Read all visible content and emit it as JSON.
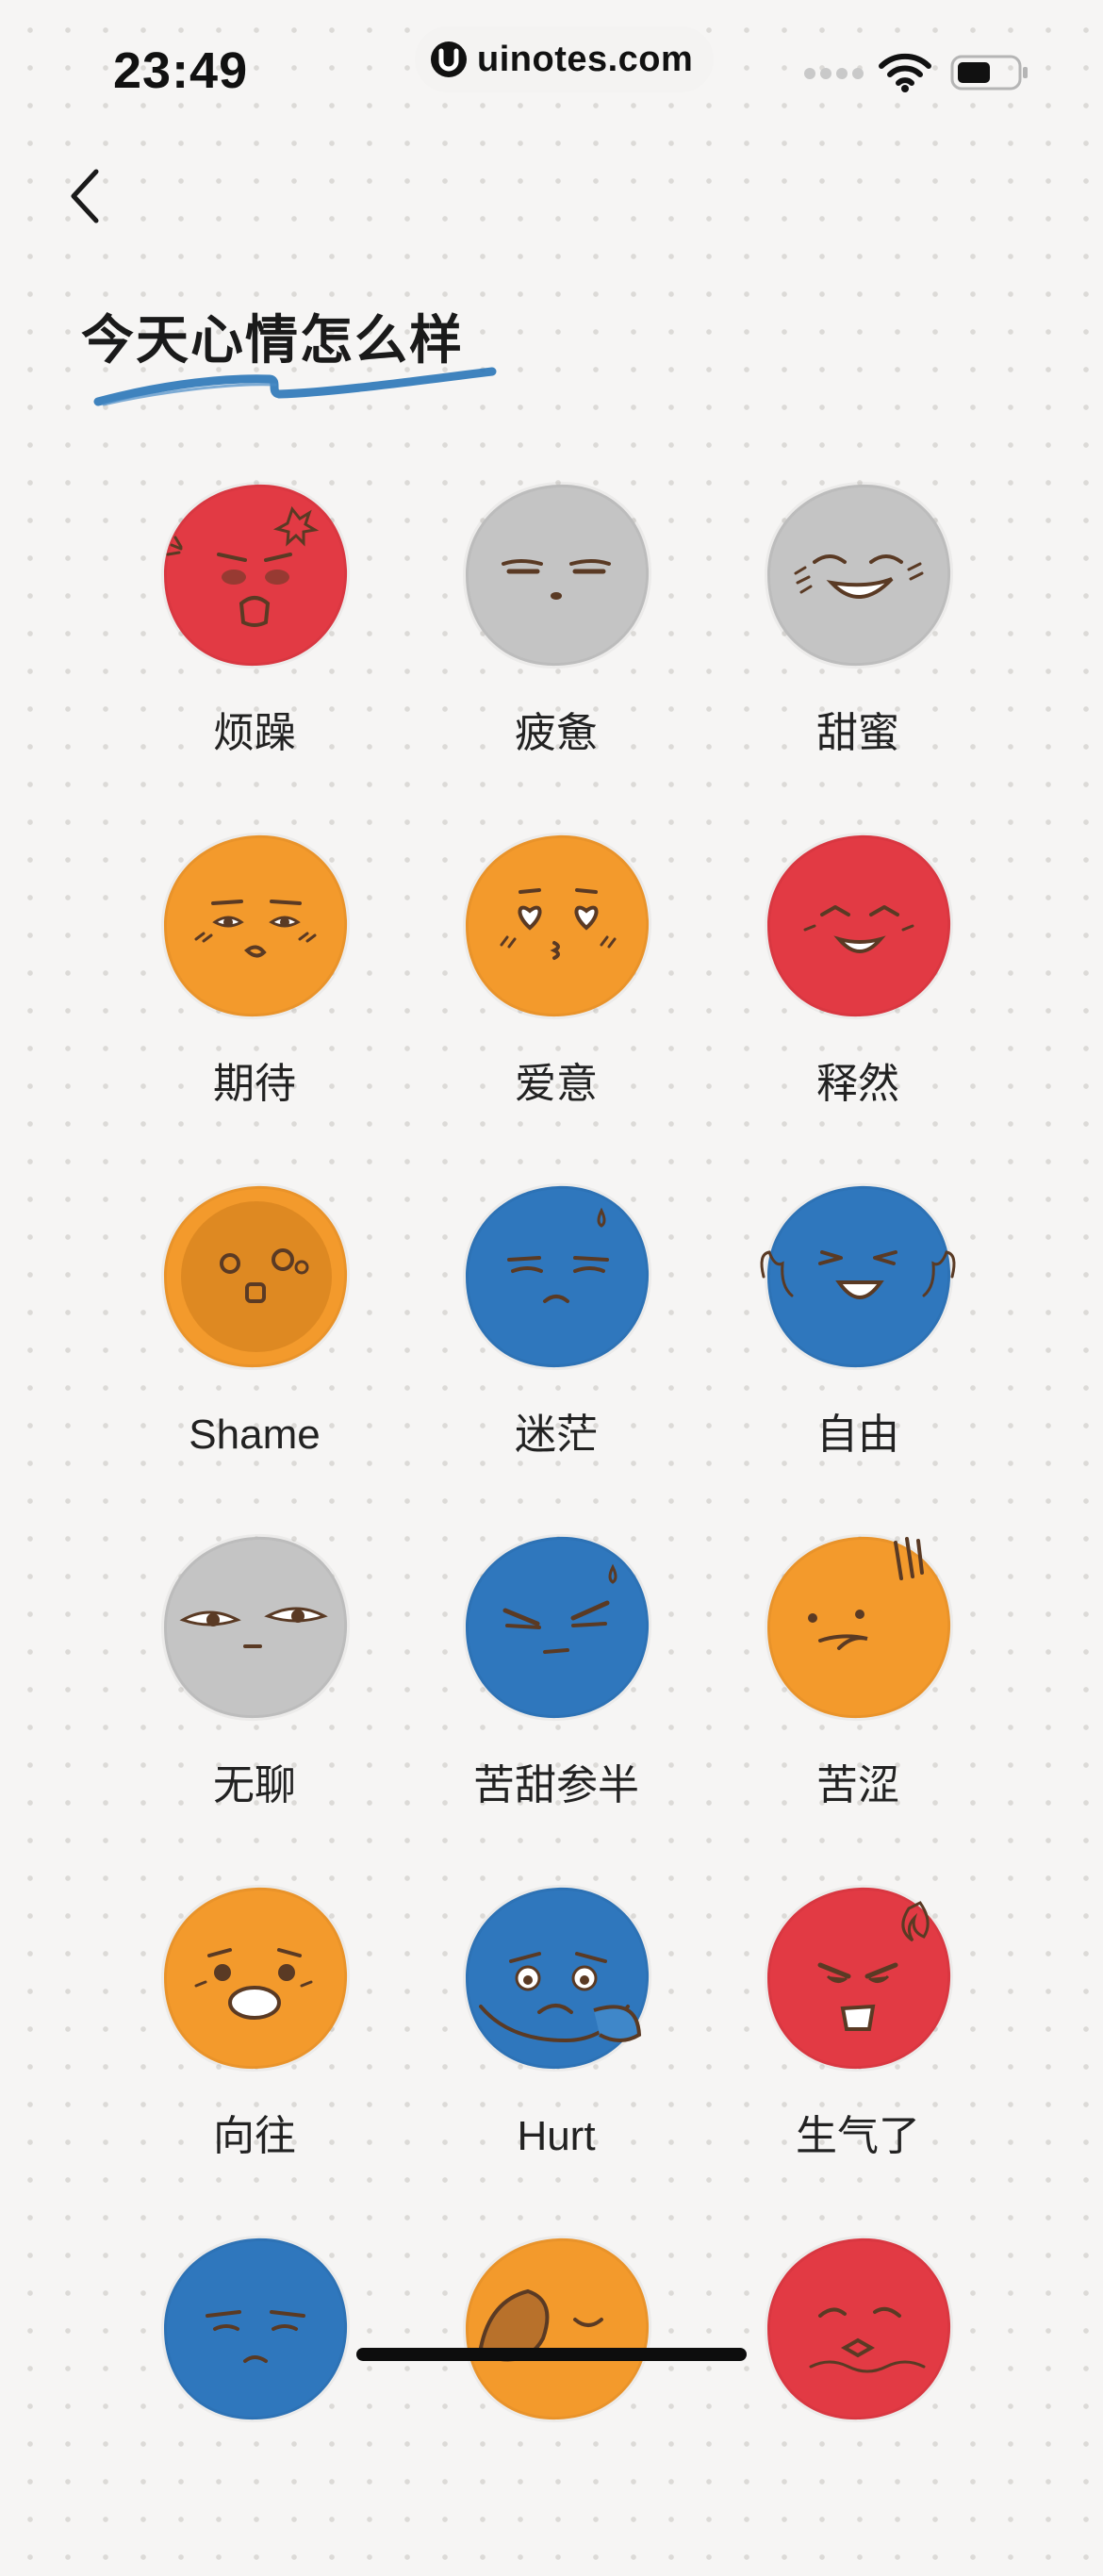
{
  "status_bar": {
    "time": "23:49",
    "watermark_text": "uinotes.com",
    "icons": [
      "signal-icon",
      "wifi-icon",
      "battery-icon"
    ]
  },
  "nav": {
    "back_icon": "chevron-left-icon"
  },
  "page": {
    "title": "今天心情怎么样",
    "underline_color": "#2f78b8"
  },
  "colors": {
    "red": "#e23a44",
    "gray": "#c4c4c4",
    "orange": "#f39a2c",
    "blue": "#2f77bd",
    "background": "#f6f5f4",
    "feature": "#5a3a24"
  },
  "moods": [
    {
      "label": "烦躁",
      "color": "red",
      "expression": "irritated"
    },
    {
      "label": "疲惫",
      "color": "gray",
      "expression": "tired"
    },
    {
      "label": "甜蜜",
      "color": "gray",
      "expression": "sweet"
    },
    {
      "label": "期待",
      "color": "orange",
      "expression": "expectant"
    },
    {
      "label": "爱意",
      "color": "orange",
      "expression": "love"
    },
    {
      "label": "释然",
      "color": "red",
      "expression": "relieved"
    },
    {
      "label": "Shame",
      "color": "orange",
      "expression": "shame"
    },
    {
      "label": "迷茫",
      "color": "blue",
      "expression": "confused"
    },
    {
      "label": "自由",
      "color": "blue",
      "expression": "free"
    },
    {
      "label": "无聊",
      "color": "gray",
      "expression": "bored"
    },
    {
      "label": "苦甜参半",
      "color": "blue",
      "expression": "bittersweet"
    },
    {
      "label": "苦涩",
      "color": "orange",
      "expression": "bitter"
    },
    {
      "label": "向往",
      "color": "orange",
      "expression": "yearning"
    },
    {
      "label": "Hurt",
      "color": "blue",
      "expression": "hurt"
    },
    {
      "label": "生气了",
      "color": "red",
      "expression": "angry"
    },
    {
      "label": "",
      "color": "blue",
      "expression": "worried"
    },
    {
      "label": "",
      "color": "orange",
      "expression": "sleepy"
    },
    {
      "label": "",
      "color": "red",
      "expression": "pouting"
    }
  ]
}
